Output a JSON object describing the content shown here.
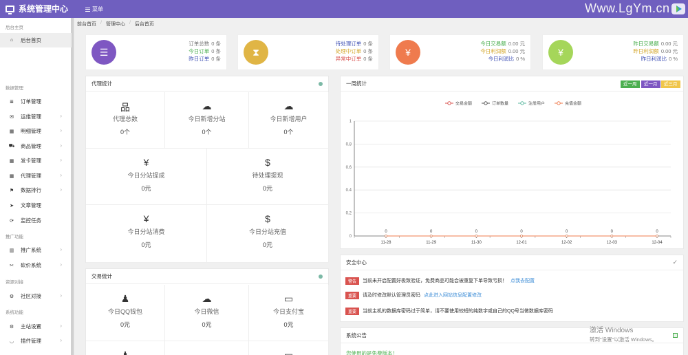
{
  "topbar": {
    "title": "系统管理中心",
    "menu": "菜单",
    "watermark": "Www.LgYm.cn"
  },
  "breadcrumb": [
    "前台首页",
    "管理中心",
    "后台首页"
  ],
  "sidebar": {
    "groups": [
      "后台主页",
      "数据管理",
      "推广功能",
      "资源对接",
      "系统功能"
    ],
    "items": [
      {
        "label": "后台首页",
        "icon": "home-icon",
        "glyph": "⌂"
      },
      {
        "label": "订单管理",
        "icon": "list-icon",
        "glyph": "≣"
      },
      {
        "label": "运维管理",
        "icon": "comments-icon",
        "glyph": "✉"
      },
      {
        "label": "明细管理",
        "icon": "table-icon",
        "glyph": "▦"
      },
      {
        "label": "商品管理",
        "icon": "cart-icon",
        "glyph": "⛟"
      },
      {
        "label": "发卡管理",
        "icon": "grid-icon",
        "glyph": "▦"
      },
      {
        "label": "代理管理",
        "icon": "th-icon",
        "glyph": "▦"
      },
      {
        "label": "数据排行",
        "icon": "flag-icon",
        "glyph": "⚑"
      },
      {
        "label": "文章管理",
        "icon": "send-icon",
        "glyph": "➤"
      },
      {
        "label": "监控任务",
        "icon": "refresh-icon",
        "glyph": "⟳"
      },
      {
        "label": "推广系统",
        "icon": "chart-icon",
        "glyph": "▥"
      },
      {
        "label": "砍价系统",
        "icon": "cutlery-icon",
        "glyph": "✂"
      },
      {
        "label": "社区对接",
        "icon": "cogs-icon",
        "glyph": "⚙"
      },
      {
        "label": "主站设置",
        "icon": "cog-icon",
        "glyph": "⚙"
      },
      {
        "label": "插件管理",
        "icon": "magnet-icon",
        "glyph": "◡"
      }
    ]
  },
  "stats": [
    {
      "color": "#7e57c2",
      "glyph": "☰",
      "rows": [
        {
          "label": "订单总数",
          "value": "0 条",
          "color": "#777"
        },
        {
          "label": "今日订单",
          "value": "0 条",
          "color": "#4caf50"
        },
        {
          "label": "昨日订单",
          "value": "0 条",
          "color": "#3f51b5"
        }
      ]
    },
    {
      "color": "#e0b545",
      "glyph": "⧗",
      "rows": [
        {
          "label": "待处理订单",
          "value": "0 条",
          "color": "#3f51b5"
        },
        {
          "label": "处理中订单",
          "value": "0 条",
          "color": "#d4a72c"
        },
        {
          "label": "异常中订单",
          "value": "0 条",
          "color": "#d9534f"
        }
      ]
    },
    {
      "color": "#ef7b4e",
      "glyph": "¥",
      "rows": [
        {
          "label": "今日交易额",
          "value": "0.00 元",
          "color": "#4caf50"
        },
        {
          "label": "今日利润额",
          "value": "0.00 元",
          "color": "#d4a72c"
        },
        {
          "label": "今日利润比",
          "value": "0 %",
          "color": "#3f51b5"
        }
      ]
    },
    {
      "color": "#a5d65a",
      "glyph": "¥",
      "rows": [
        {
          "label": "昨日交易额",
          "value": "0.00 元",
          "color": "#4caf50"
        },
        {
          "label": "昨日利润额",
          "value": "0.00 元",
          "color": "#d4a72c"
        },
        {
          "label": "昨日利润比",
          "value": "0 %",
          "color": "#3f51b5"
        }
      ]
    }
  ],
  "agent": {
    "title": "代理统计",
    "cells": [
      {
        "label": "代理总数",
        "value": "0个",
        "icon": "sitemap-icon",
        "glyph": "品"
      },
      {
        "label": "今日新增分站",
        "value": "0个",
        "icon": "cloud-icon",
        "glyph": "☁"
      },
      {
        "label": "今日新增用户",
        "value": "0个",
        "icon": "cloud-icon",
        "glyph": "☁"
      },
      {
        "label": "今日分站提成",
        "value": "0元",
        "icon": "yen-icon",
        "glyph": "¥"
      },
      {
        "label": "待处理提现",
        "value": "0元",
        "icon": "money-icon",
        "glyph": "$"
      },
      {
        "label": "今日分站消费",
        "value": "0元",
        "icon": "yen-icon",
        "glyph": "¥"
      },
      {
        "label": "今日分站充值",
        "value": "0元",
        "icon": "money-icon",
        "glyph": "$"
      }
    ]
  },
  "trade": {
    "title": "交易统计",
    "cells": [
      {
        "label": "今日QQ钱包",
        "value": "0元",
        "icon": "qq-icon",
        "glyph": "♟"
      },
      {
        "label": "今日微信",
        "value": "0元",
        "icon": "wechat-icon",
        "glyph": "☁"
      },
      {
        "label": "今日支付宝",
        "value": "0元",
        "icon": "card-icon",
        "glyph": "▭"
      }
    ]
  },
  "weekly": {
    "title": "一周统计",
    "buttons": [
      {
        "label": "近一周",
        "color": "#4caf50"
      },
      {
        "label": "近一月",
        "color": "#7e57c2"
      },
      {
        "label": "近三月",
        "color": "#f0c64b"
      }
    ]
  },
  "chart_data": {
    "type": "line",
    "title": "",
    "x": [
      "11-28",
      "11-29",
      "11-30",
      "12-01",
      "12-02",
      "12-03",
      "12-04"
    ],
    "series": [
      {
        "name": "交易金额",
        "color": "#d9534f",
        "values": [
          0,
          0,
          0,
          0,
          0,
          0,
          0
        ]
      },
      {
        "name": "订单数量",
        "color": "#555555",
        "values": [
          0,
          0,
          0,
          0,
          0,
          0,
          0
        ]
      },
      {
        "name": "注册用户",
        "color": "#5cb8a0",
        "values": [
          0,
          0,
          0,
          0,
          0,
          0,
          0
        ]
      },
      {
        "name": "充值金额",
        "color": "#ef7b4e",
        "values": [
          0,
          0,
          0,
          0,
          0,
          0,
          0
        ]
      }
    ],
    "yticks": [
      "0",
      "0.2",
      "0.4",
      "0.6",
      "0.8",
      "1"
    ],
    "ylim": [
      0,
      1
    ],
    "grid": true,
    "legend": "top-center",
    "data_labels": [
      "0",
      "0",
      "0",
      "0",
      "0",
      "0",
      "0"
    ]
  },
  "security": {
    "title": "安全中心",
    "rows": [
      {
        "badge": "警告",
        "text": "当前未开启配置好极致验证，免费商品可能会被重复下单导致亏损！",
        "link": "点我去配置"
      },
      {
        "badge": "重要",
        "text": "请及时修改默认管理员密码",
        "link": "点此进入网站信息配置修改"
      },
      {
        "badge": "重要",
        "text": "当前主机的数据库密码过于简单，请不要使用较短的纯数字或自己的QQ号当做数据库密码",
        "link": ""
      }
    ]
  },
  "notice": {
    "title": "系统公告",
    "text": "您使用的是免费版本！"
  },
  "windows": {
    "line1": "激活 Windows",
    "line2": "转到\"设置\"以激活 Windows。"
  }
}
